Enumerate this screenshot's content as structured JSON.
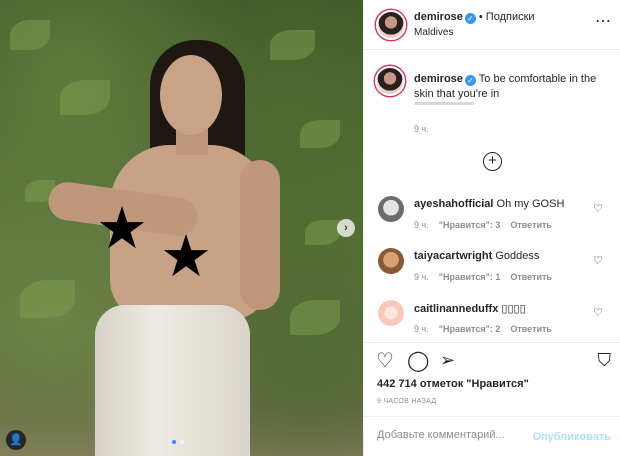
{
  "post": {
    "username": "demirose",
    "verified_icon": "verified-badge-icon",
    "separator": "•",
    "follow_label": "Подписки",
    "location": "Maldives",
    "caption": "To be comfortable in the skin that you're in",
    "caption_time": "9 ч.",
    "likes": "442 714 отметок \"Нравится\"",
    "timestamp": "9 ЧАСОВ НАЗАД"
  },
  "comments": [
    {
      "username": "ayeshahofficial",
      "text": "Oh my GOSH",
      "time": "9 ч.",
      "likes": "\"Нравится\": 3",
      "reply": "Ответить"
    },
    {
      "username": "taiyacartwright",
      "text": "Goddess",
      "time": "9 ч.",
      "likes": "\"Нравится\": 1",
      "reply": "Ответить"
    },
    {
      "username": "caitlinanneduffx",
      "text": "",
      "time": "9 ч.",
      "likes": "\"Нравится\": 2",
      "reply": "Ответить"
    }
  ],
  "comment_box": {
    "placeholder": "Добавьте комментарий...",
    "publish_label": "Опубликовать"
  },
  "colors": {
    "verified": "#3897f0",
    "publish": "#b2dffc",
    "active_dot": "#2d8cf0"
  }
}
